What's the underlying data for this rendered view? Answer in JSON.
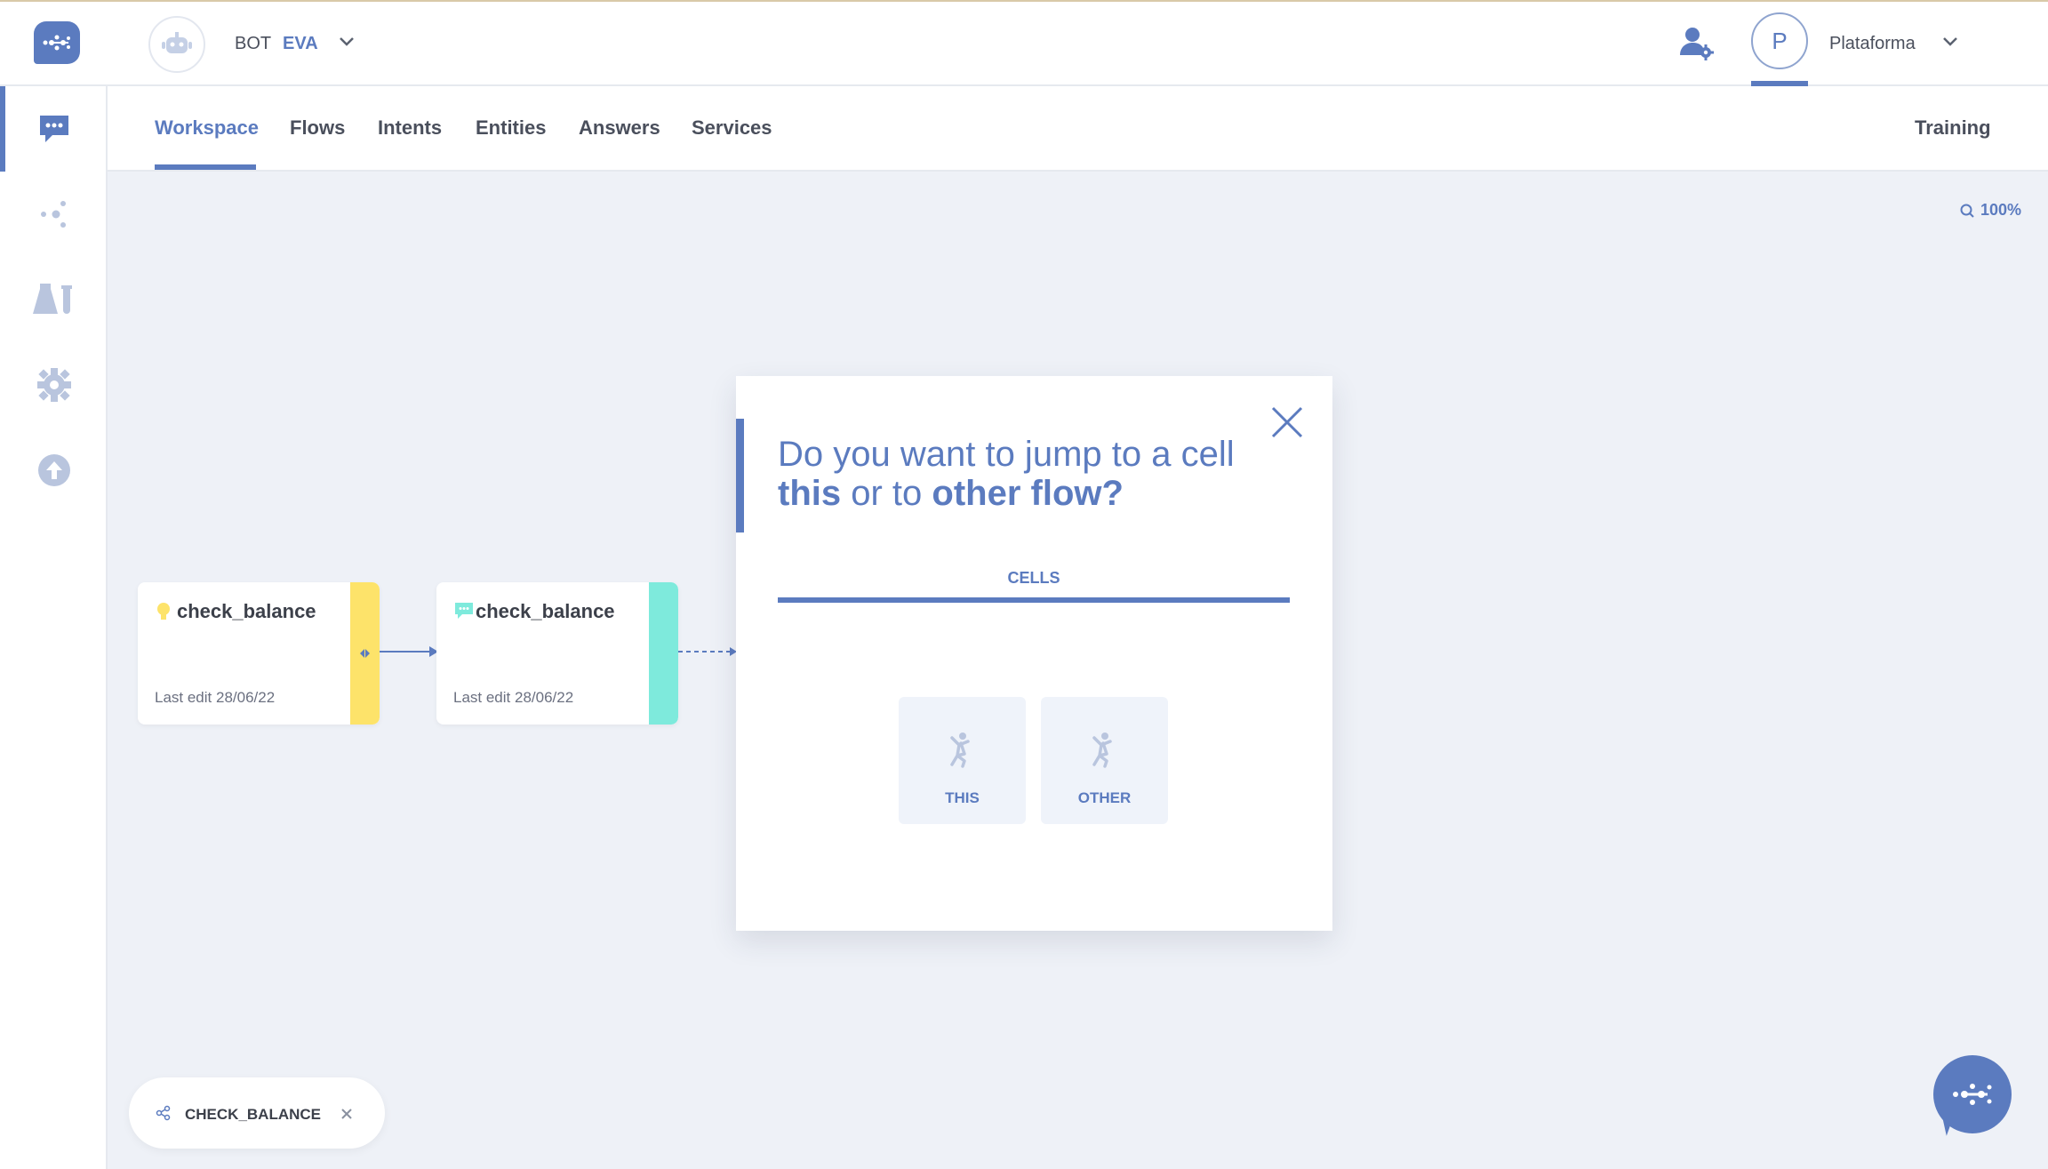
{
  "header": {
    "bot_label": "BOT",
    "bot_name": "EVA",
    "user_initial": "P",
    "user_name": "Plataforma"
  },
  "sidebar": {
    "items": [
      {
        "name": "chat-icon",
        "active": true
      },
      {
        "name": "flow-nodes-icon",
        "active": false
      },
      {
        "name": "lab-test-icon",
        "active": false
      },
      {
        "name": "gear-icon",
        "active": false
      },
      {
        "name": "upload-icon",
        "active": false
      }
    ]
  },
  "tabs": {
    "items": [
      "Workspace",
      "Flows",
      "Intents",
      "Entities",
      "Answers",
      "Services"
    ],
    "active": "Workspace",
    "training": "Training"
  },
  "zoom": "100%",
  "cards": [
    {
      "title": "check_balance",
      "meta": "Last edit 28/06/22",
      "icon": "lightbulb-icon",
      "stripe_color": "#fde36a"
    },
    {
      "title": "check_balance",
      "meta": "Last edit 28/06/22",
      "icon": "message-icon",
      "stripe_color": "#7eeadc"
    }
  ],
  "modal": {
    "title_line1": "Do you want to jump to a cell",
    "title_this": "this",
    "title_or_to": " or to ",
    "title_other": "other flow?",
    "tab": "CELLS",
    "choices": [
      "THIS",
      "OTHER"
    ]
  },
  "chip": {
    "label": "CHECK_BALANCE"
  },
  "colors": {
    "accent": "#5b7bbf",
    "background": "#eef1f7",
    "yellow": "#fde36a",
    "teal": "#7eeadc"
  }
}
